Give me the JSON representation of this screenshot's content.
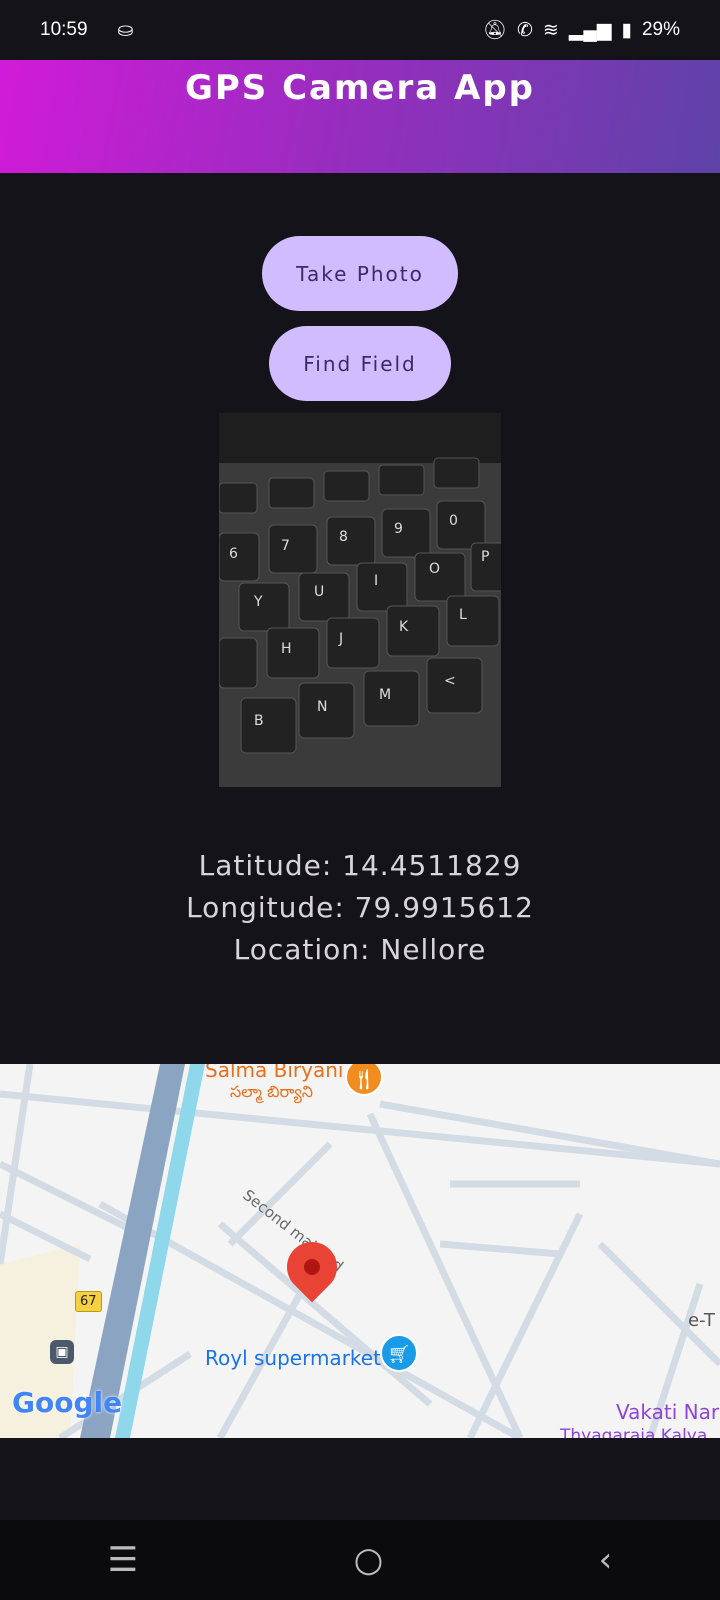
{
  "status_bar": {
    "time": "10:59",
    "battery": "29%",
    "icons": [
      "android-debug-icon",
      "mute-icon",
      "wifi-call-icon",
      "wifi-icon",
      "signal-icon",
      "battery-charging-icon"
    ]
  },
  "app_bar": {
    "title": "GPS Camera App",
    "gradient": [
      "#d11bd8",
      "#5e43a8"
    ]
  },
  "actions": {
    "take_photo": "Take Photo",
    "find_field": "Find Field"
  },
  "location": {
    "latitude": "Latitude: 14.4511829",
    "longitude": "Longitude: 79.9915612",
    "location": "Location: Nellore"
  },
  "map": {
    "labels": {
      "restaurant": "Salma Biryani",
      "restaurant_local": "సల్మా బిర్యాని",
      "road": "Second main Rd",
      "store": "Royl supermarket",
      "highway": "67",
      "edge_label": "e-T",
      "temple": "Vakati Nars",
      "temple2": "Thyagaraja Kalya"
    },
    "logo": "Google"
  },
  "nav": {
    "icons": [
      "menu-icon",
      "home-icon",
      "back-icon"
    ]
  }
}
